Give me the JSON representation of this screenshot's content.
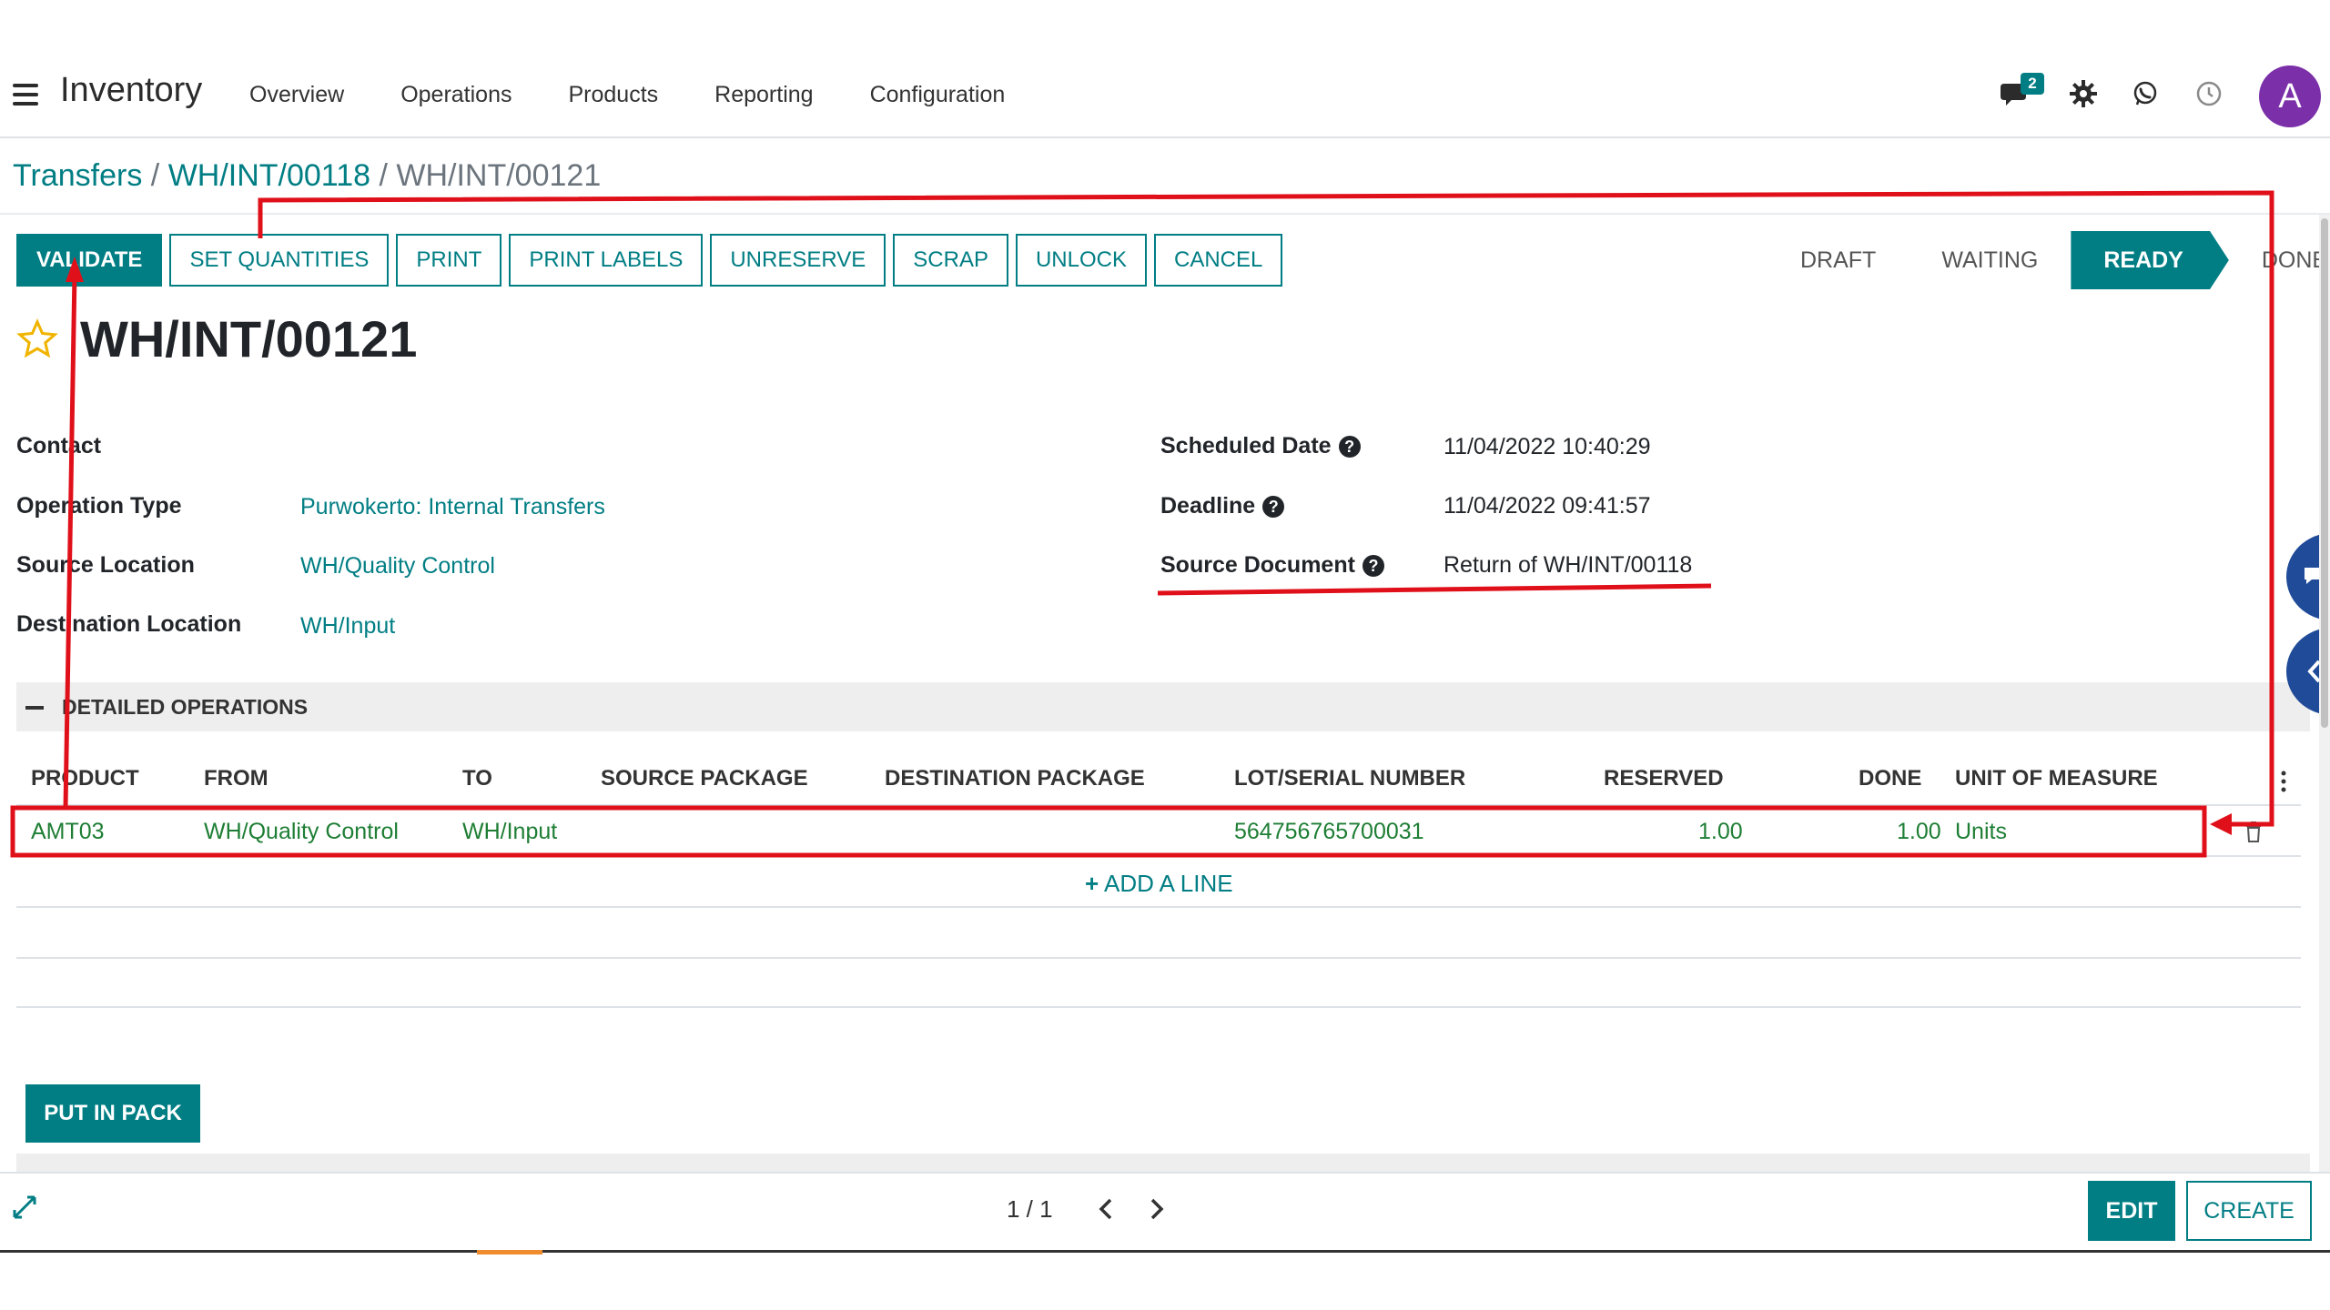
{
  "app": {
    "title": "Inventory"
  },
  "nav": {
    "items": [
      {
        "label": "Overview"
      },
      {
        "label": "Operations"
      },
      {
        "label": "Products"
      },
      {
        "label": "Reporting"
      },
      {
        "label": "Configuration"
      }
    ],
    "chat_badge": "2",
    "avatar_letter": "A"
  },
  "breadcrumb": {
    "root": "Transfers",
    "parent": "WH/INT/00118",
    "current": "WH/INT/00121",
    "sep": "/"
  },
  "actions": {
    "validate": "VALIDATE",
    "set_quantities": "SET QUANTITIES",
    "print": "PRINT",
    "print_labels": "PRINT LABELS",
    "unreserve": "UNRESERVE",
    "scrap": "SCRAP",
    "unlock": "UNLOCK",
    "cancel": "CANCEL"
  },
  "status": {
    "stages": [
      "DRAFT",
      "WAITING",
      "READY",
      "DONE"
    ],
    "active": "READY"
  },
  "record": {
    "title": "WH/INT/00121"
  },
  "fields": {
    "contact_label": "Contact",
    "operation_type_label": "Operation Type",
    "operation_type_value": "Purwokerto: Internal Transfers",
    "source_location_label": "Source Location",
    "source_location_value": "WH/Quality Control",
    "destination_location_label": "Destination Location",
    "destination_location_value": "WH/Input",
    "scheduled_date_label": "Scheduled Date",
    "scheduled_date_value": "11/04/2022 10:40:29",
    "deadline_label": "Deadline",
    "deadline_value": "11/04/2022 09:41:57",
    "source_document_label": "Source Document",
    "source_document_value": "Return of WH/INT/00118",
    "help_glyph": "?"
  },
  "detailed_operations": {
    "title": "DETAILED OPERATIONS",
    "headers": {
      "product": "PRODUCT",
      "from": "FROM",
      "to": "TO",
      "source_package": "SOURCE PACKAGE",
      "destination_package": "DESTINATION PACKAGE",
      "lot_serial": "LOT/SERIAL NUMBER",
      "reserved": "RESERVED",
      "done": "DONE",
      "uom": "UNIT OF MEASURE"
    },
    "row": {
      "product": "AMT03",
      "from": "WH/Quality Control",
      "to": "WH/Input",
      "lot_serial": "564756765700031",
      "reserved": "1.00",
      "done": "1.00",
      "uom": "Units"
    },
    "add_line": "ADD A LINE",
    "put_in_pack": "PUT IN PACK"
  },
  "pager": {
    "value": "1 / 1"
  },
  "footer": {
    "edit": "EDIT",
    "create": "CREATE"
  },
  "colors": {
    "primary": "#017e84",
    "annotation": "#e0101a",
    "avatar": "#7b2fa8"
  },
  "icons": {
    "menu": "hamburger-icon",
    "chat": "chat-icon",
    "settings": "gear-icon",
    "whatsapp": "whatsapp-icon",
    "activity": "clock-icon",
    "favorite": "star-icon",
    "delete": "trash-icon",
    "prev": "chevron-left-icon",
    "next": "chevron-right-icon",
    "expand": "expand-icon"
  }
}
